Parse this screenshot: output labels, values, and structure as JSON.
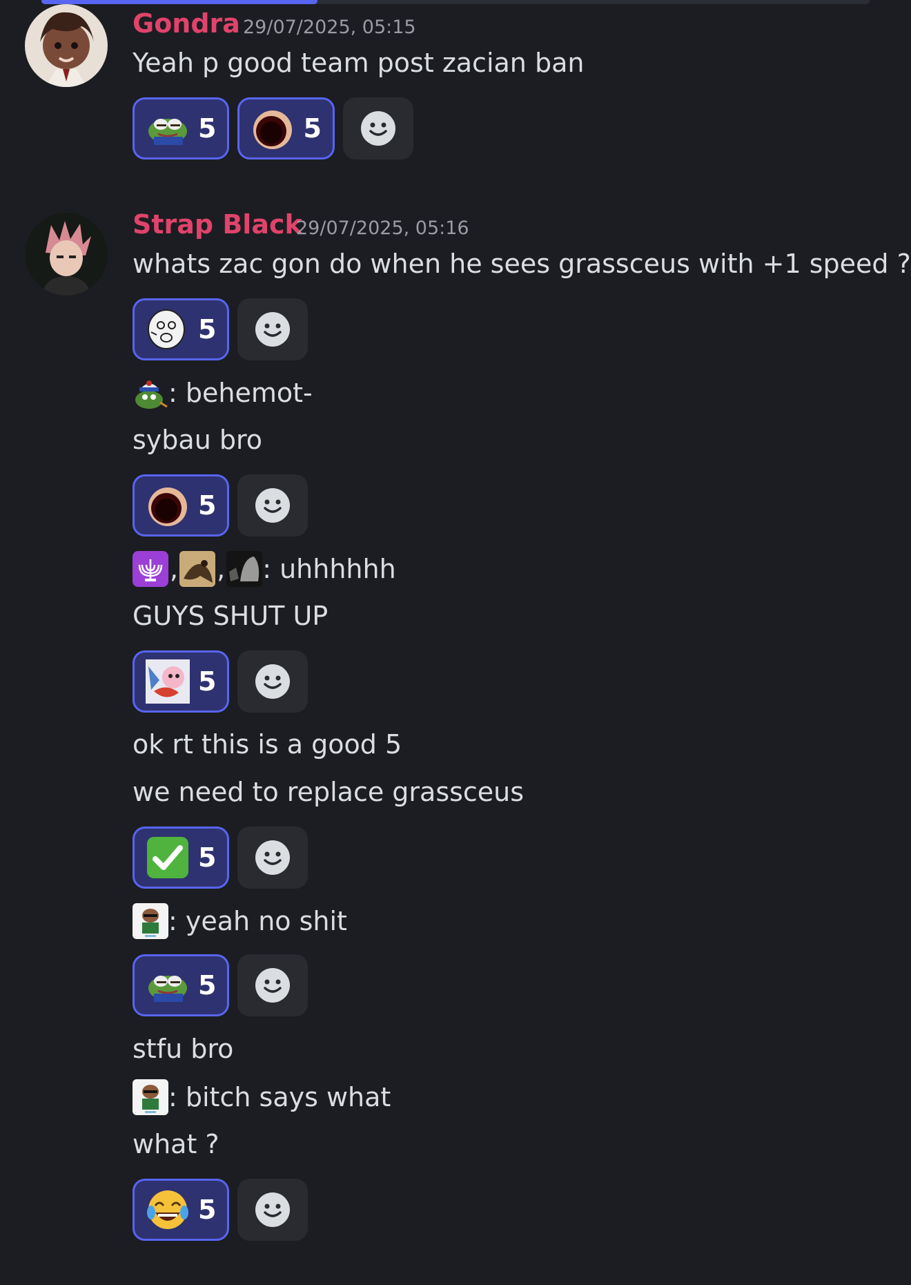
{
  "messages": [
    {
      "username": "Gondra",
      "timestamp": "29/07/2025, 05:15",
      "text": "Yeah p good team post zacian ban",
      "reactions": [
        {
          "emoji": "pepe-frog-icon",
          "count": "5"
        },
        {
          "emoji": "dark-hole-icon",
          "count": "5"
        }
      ]
    },
    {
      "username": "Strap Black",
      "timestamp": "29/07/2025, 05:16",
      "lines": [
        "whats zac gon do when he sees grassceus with +1 speed ?",
        ": behemot-",
        "sybau bro",
        ": uhhhhhh",
        "GUYS SHUT UP",
        "ok rt this is a good 5",
        "we need to replace grassceus",
        ": yeah no shit",
        "stfu bro",
        ": bitch says what",
        "what ?"
      ],
      "separator": ",",
      "reaction_groups": [
        [
          {
            "emoji": "meme-face-icon",
            "count": "5"
          }
        ],
        [
          {
            "emoji": "dark-hole-icon",
            "count": "5"
          }
        ],
        [
          {
            "emoji": "pokemon-art-icon",
            "count": "5"
          }
        ],
        [
          {
            "emoji": "green-checkmark-icon",
            "count": "5"
          }
        ],
        [
          {
            "emoji": "pepe-frog-icon",
            "count": "5"
          }
        ],
        [
          {
            "emoji": "laughing-crying-icon",
            "count": "5"
          }
        ]
      ]
    }
  ],
  "colors": {
    "background": "#1c1d22",
    "username": "#e0436b",
    "reaction_bg": "#2f3270",
    "reaction_border": "#5865f2"
  }
}
